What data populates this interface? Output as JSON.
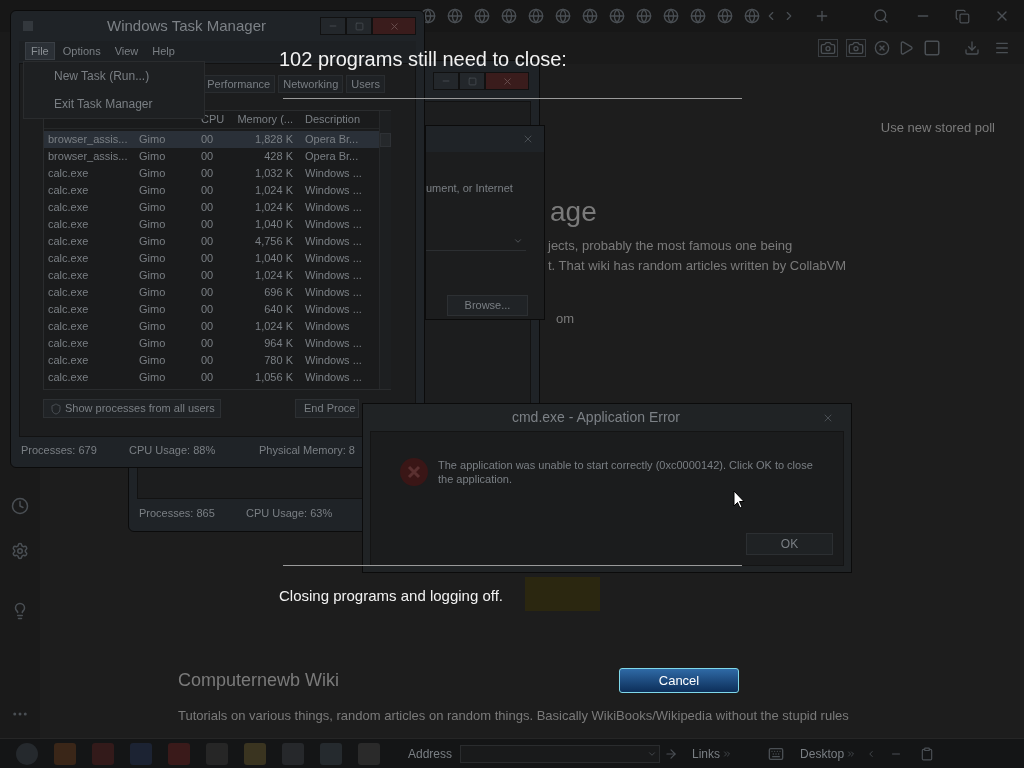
{
  "task_manager": {
    "title": "Windows Task Manager",
    "menu": [
      {
        "label": "File",
        "selected": true
      },
      {
        "label": "Options",
        "selected": false
      },
      {
        "label": "View",
        "selected": false
      },
      {
        "label": "Help",
        "selected": false
      }
    ],
    "file_menu": [
      "New Task (Run...)",
      "Exit Task Manager"
    ],
    "tabs": [
      {
        "label": "Performance",
        "selected": false
      },
      {
        "label": "Networking",
        "selected": false
      },
      {
        "label": "Users",
        "selected": false
      }
    ],
    "columns": [
      "",
      "",
      "CPU",
      "Memory (...",
      "Description"
    ],
    "rows": [
      {
        "cells": [
          "browser_assis...",
          "Gimo",
          "00",
          "1,828 K",
          "Opera Br..."
        ],
        "selected": true
      },
      {
        "cells": [
          "browser_assis...",
          "Gimo",
          "00",
          "428 K",
          "Opera Br..."
        ],
        "selected": false
      },
      {
        "cells": [
          "calc.exe",
          "Gimo",
          "00",
          "1,032 K",
          "Windows ..."
        ],
        "selected": false
      },
      {
        "cells": [
          "calc.exe",
          "Gimo",
          "00",
          "1,024 K",
          "Windows ..."
        ],
        "selected": false
      },
      {
        "cells": [
          "calc.exe",
          "Gimo",
          "00",
          "1,024 K",
          "Windows ..."
        ],
        "selected": false
      },
      {
        "cells": [
          "calc.exe",
          "Gimo",
          "00",
          "1,040 K",
          "Windows ..."
        ],
        "selected": false
      },
      {
        "cells": [
          "calc.exe",
          "Gimo",
          "00",
          "4,756 K",
          "Windows ..."
        ],
        "selected": false
      },
      {
        "cells": [
          "calc.exe",
          "Gimo",
          "00",
          "1,040 K",
          "Windows ..."
        ],
        "selected": false
      },
      {
        "cells": [
          "calc.exe",
          "Gimo",
          "00",
          "1,024 K",
          "Windows ..."
        ],
        "selected": false
      },
      {
        "cells": [
          "calc.exe",
          "Gimo",
          "00",
          "696 K",
          "Windows ..."
        ],
        "selected": false
      },
      {
        "cells": [
          "calc.exe",
          "Gimo",
          "00",
          "640 K",
          "Windows ..."
        ],
        "selected": false
      },
      {
        "cells": [
          "calc.exe",
          "Gimo",
          "00",
          "1,024 K",
          "Windows"
        ],
        "selected": false
      },
      {
        "cells": [
          "calc.exe",
          "Gimo",
          "00",
          "964 K",
          "Windows ..."
        ],
        "selected": false
      },
      {
        "cells": [
          "calc.exe",
          "Gimo",
          "00",
          "780 K",
          "Windows ..."
        ],
        "selected": false
      },
      {
        "cells": [
          "calc.exe",
          "Gimo",
          "00",
          "1,056 K",
          "Windows ..."
        ],
        "selected": false
      }
    ],
    "show_all_button": "Show processes from all users",
    "end_button": "End Proce",
    "status_bar": [
      "Processes: 679",
      "CPU Usage: 88%",
      "Physical Memory: 8"
    ]
  },
  "task_manager_back": {
    "status_bar": [
      "Processes: 865",
      "CPU Usage: 63%"
    ]
  },
  "run_dialog": {
    "text": "ument, or Internet",
    "browse_button": "Browse..."
  },
  "browser": {
    "notice": "Use new stored poll",
    "heading": "age",
    "lines": [
      "jects, probably the most famous one being",
      "t. That wiki has random articles written by CollabVM"
    ],
    "fragment": "om",
    "wiki_title": "Computernewb Wiki",
    "wiki_description": "Tutorials on various things, random articles on random things. Basically WikiBooks/Wikipedia without the stupid rules"
  },
  "error_dialog": {
    "title": "cmd.exe - Application Error",
    "message": "The application was unable to start correctly (0xc0000142). Click OK to close the application.",
    "ok_button": "OK"
  },
  "taskbar": {
    "address_label": "Address",
    "links": "Links",
    "desktop": "Desktop"
  },
  "logoff": {
    "heading": "102 programs still need to close:",
    "status": "Closing programs and logging off.",
    "cancel_button": "Cancel"
  }
}
